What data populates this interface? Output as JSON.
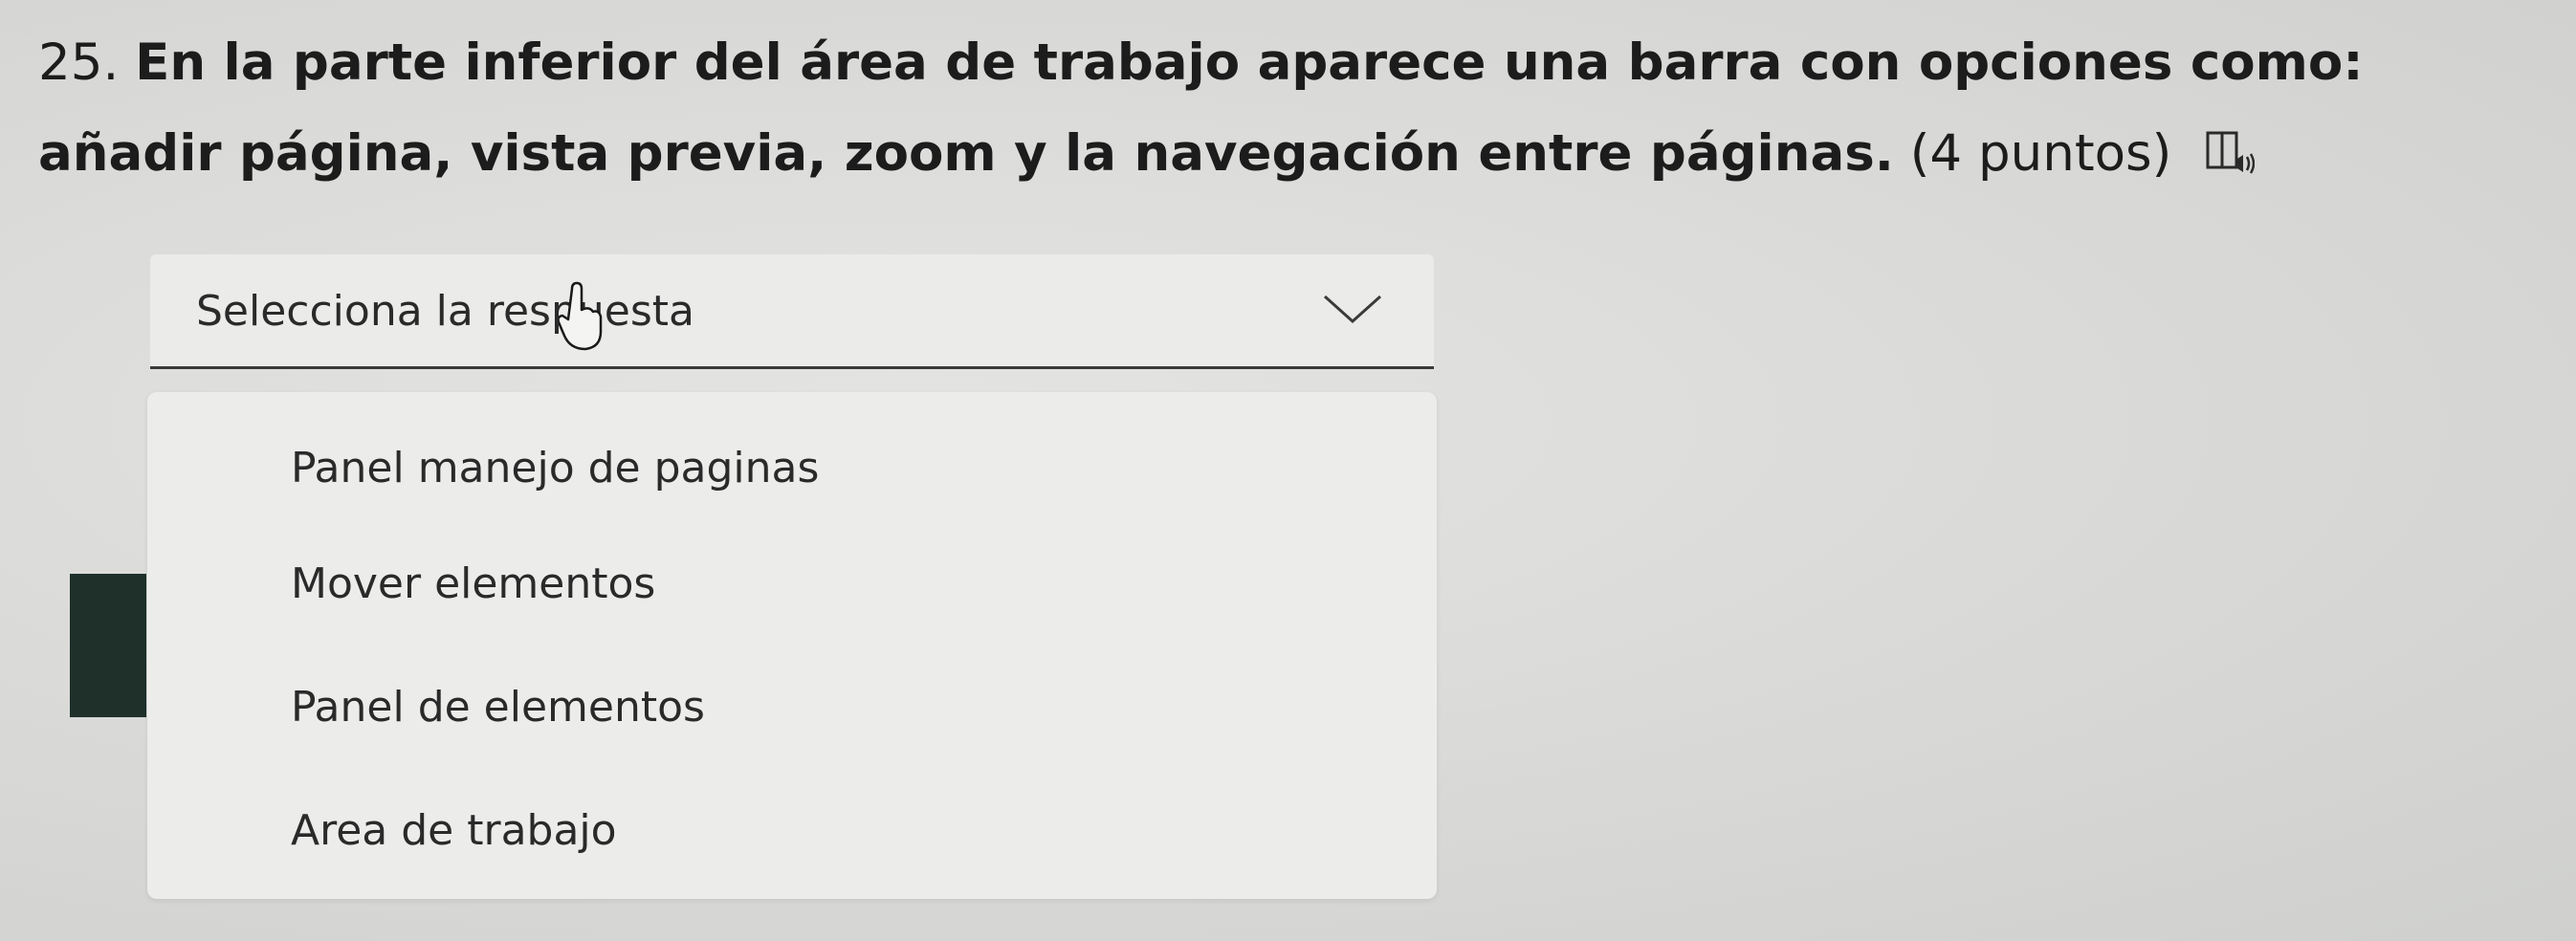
{
  "question": {
    "number": "25.",
    "text": "En la parte inferior del área de trabajo aparece una barra con opciones como: añadir página, vista previa, zoom y la navegación entre páginas.",
    "points": "(4 puntos)",
    "reader_icon": "immersive-reader-icon"
  },
  "select": {
    "placeholder": "Selecciona la respuesta",
    "chevron_icon": "chevron-down-icon",
    "expanded": true
  },
  "options": [
    "Panel manejo de paginas",
    "Mover elementos",
    "Panel de elementos",
    "Area de trabajo"
  ],
  "colors": {
    "background": "#dcdcda",
    "field": "#ebebea",
    "underline": "#3a3a3a",
    "marker": "#1f302b"
  }
}
